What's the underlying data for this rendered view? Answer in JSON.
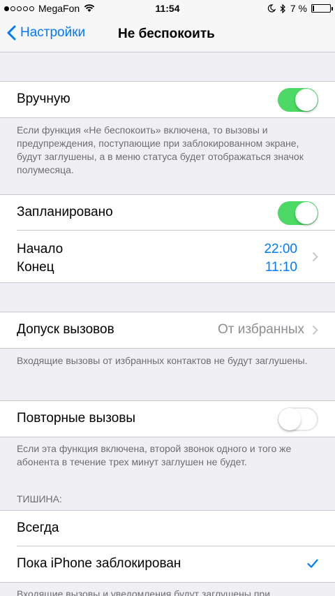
{
  "statusbar": {
    "carrier": "MegaFon",
    "time": "11:54",
    "battery": "7 %",
    "battery_level": 0.07,
    "signal_bars": 1
  },
  "nav": {
    "back_label": "Настройки",
    "title": "Не беспокоить"
  },
  "manual": {
    "label": "Вручную",
    "enabled": true,
    "footer": "Если функция «Не беспокоить» включена, то вызовы и предупреждения, поступающие при заблокированном экране, будут заглушены, а в меню статуса будет отображаться значок полумесяца."
  },
  "scheduled": {
    "label": "Запланировано",
    "enabled": true,
    "start_label": "Начало",
    "end_label": "Конец",
    "start_time": "22:00",
    "end_time": "11:10"
  },
  "allow_calls": {
    "label": "Допуск вызовов",
    "value": "От избранных",
    "footer": "Входящие вызовы от избранных контактов не будут заглушены."
  },
  "repeated_calls": {
    "label": "Повторные вызовы",
    "enabled": false,
    "footer": "Если эта функция включена, второй звонок одного и того же абонента в течение трех минут заглушен не будет."
  },
  "silence": {
    "header": "ТИШИНА:",
    "options": [
      "Всегда",
      "Пока iPhone заблокирован"
    ],
    "selected_index": 1,
    "footer": "Входящие вызовы и уведомления будут заглушены при"
  },
  "colors": {
    "accent": "#007aff",
    "switch_on": "#4cd964",
    "background": "#efeff4"
  }
}
